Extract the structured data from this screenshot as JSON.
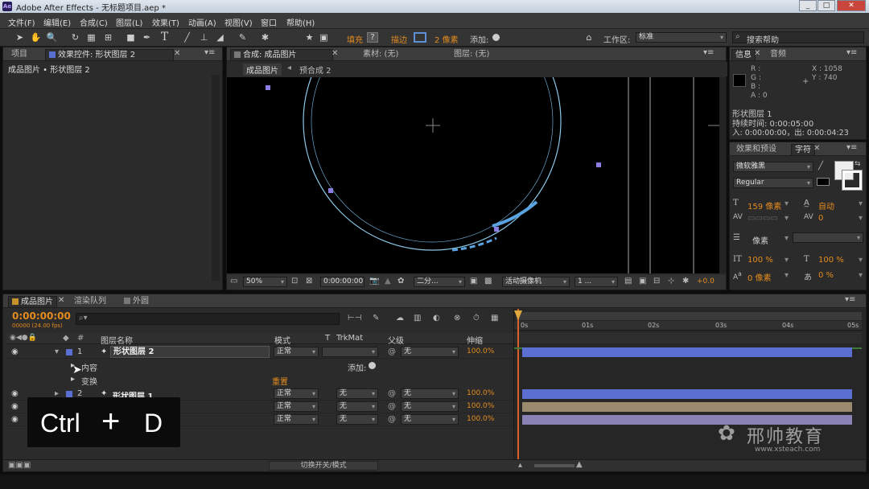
{
  "titlebar": {
    "app_icon": "Ae",
    "title": "Adobe After Effects - 无标题项目.aep *",
    "min": "_",
    "max": "□",
    "close": "✕"
  },
  "menu": [
    "文件(F)",
    "编辑(E)",
    "合成(C)",
    "图层(L)",
    "效果(T)",
    "动画(A)",
    "视图(V)",
    "窗口",
    "帮助(H)"
  ],
  "toolbar": {
    "fill_label": "填充",
    "fill_help": "?",
    "stroke_label": "描边",
    "stroke_width": "2 像素",
    "add_label": "添加:",
    "workspace_label": "工作区:",
    "workspace_value": "标准",
    "search_placeholder": "搜索帮助"
  },
  "left_panel": {
    "tabs": [
      "项目",
      "效果控件: 形状图层 2"
    ],
    "breadcrumb": "成品图片 • 形状图层 2"
  },
  "comp_panel": {
    "tabs": [
      "合成: 成品图片",
      "素材: (无)",
      "图层: (无)"
    ],
    "subtabs": [
      "成品图片",
      "预合成 2"
    ],
    "zoom": "50%",
    "timecode": "0:00:00:00",
    "resolution": "二分...",
    "camera": "活动摄像机",
    "views": "1 ...",
    "exposure": "+0.0"
  },
  "info_panel": {
    "tabs": [
      "信息",
      "音频"
    ],
    "r": "R :",
    "g": "G :",
    "b": "B :",
    "a": "A : 0",
    "x": "X : 1058",
    "y": "Y : 740",
    "layer": "形状图层 1",
    "duration": "持续时间: 0:00:05:00",
    "inout": "入: 0:00:00:00，出: 0:00:04:23"
  },
  "char_panel": {
    "tabs": [
      "效果和预设",
      "字符"
    ],
    "font": "微软雅黑",
    "style": "Regular",
    "size": "159 像素",
    "leading": "自动",
    "tracking": "0",
    "stroke_width": "像素",
    "v_scale": "100 %",
    "h_scale": "100 %",
    "baseline": "0 像素",
    "tsume": "0 %"
  },
  "timeline": {
    "tabs": [
      "成品图片",
      "渲染队列",
      "外圆"
    ],
    "timecode": "0:00:00:00",
    "fps": "00000 (24.00 fps)",
    "headers": {
      "num": "#",
      "name": "图层名称",
      "mode": "模式",
      "t": "T",
      "trkmat": "TrkMat",
      "parent": "父级",
      "stretch": "伸缩"
    },
    "ruler": [
      "0s",
      "01s",
      "02s",
      "03s",
      "04s",
      "05s"
    ],
    "layers": [
      {
        "num": "1",
        "name": "形状图层 2",
        "mode": "正常",
        "trkmat": "",
        "parent": "无",
        "stretch": "100.0%"
      },
      {
        "num": "2",
        "name": "形状图层 1",
        "mode": "正常",
        "trkmat": "无",
        "parent": "无",
        "stretch": "100.0%"
      },
      {
        "num": "3",
        "name": "",
        "mode": "正常",
        "trkmat": "无",
        "parent": "无",
        "stretch": "100.0%"
      },
      {
        "num": "4",
        "name": "",
        "mode": "正常",
        "trkmat": "无",
        "parent": "无",
        "stretch": "100.0%"
      }
    ],
    "content_label": "内容",
    "transform_label": "变换",
    "add_label": "添加:",
    "reset_label": "重置",
    "footer_toggle": "切换开关/模式"
  },
  "overlay": {
    "ctrl": "Ctrl",
    "plus": "+",
    "d": "D"
  },
  "watermark": {
    "name": "邢帅教育",
    "url": "www.xsteach.com"
  },
  "colors": {
    "accent_orange": "#e38b1e",
    "layer_blue": "#5a6fd0",
    "layer_tan": "#9c8a6f",
    "layer_lav": "#8a82b4",
    "circle": "#8cc8e8"
  }
}
